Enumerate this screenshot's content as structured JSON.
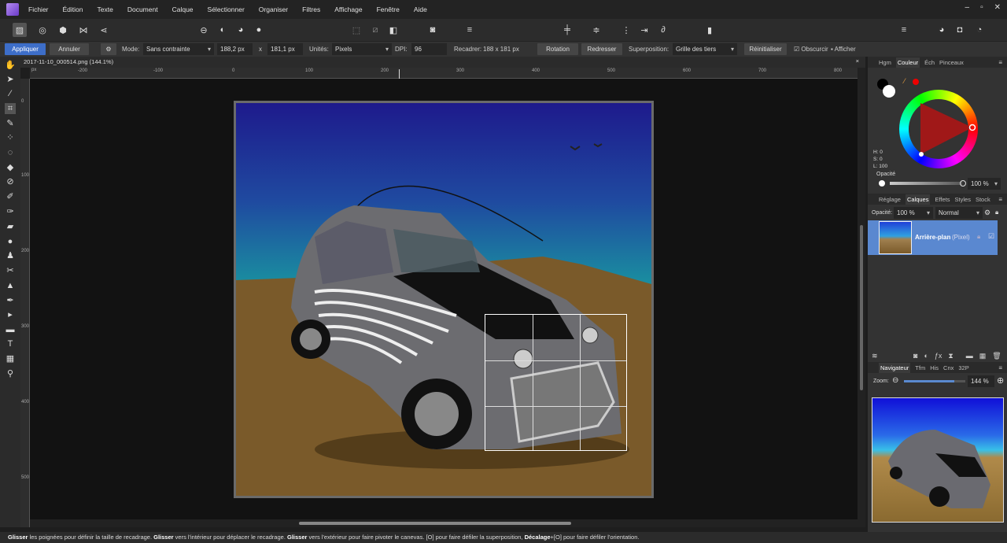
{
  "menu": [
    "Fichier",
    "Édition",
    "Texte",
    "Document",
    "Calque",
    "Sélectionner",
    "Organiser",
    "Filtres",
    "Affichage",
    "Fenêtre",
    "Aide"
  ],
  "window_controls": [
    "–",
    "▫",
    "✕"
  ],
  "context": {
    "apply": "Appliquer",
    "cancel": "Annuler",
    "mode_label": "Mode:",
    "mode_value": "Sans contrainte",
    "width": "188,2 px",
    "x_sep": "x",
    "height": "181,1 px",
    "units_label": "Unités:",
    "units_value": "Pixels",
    "dpi_label": "DPI:",
    "dpi_value": "96",
    "crop_label": "Recadrer:",
    "crop_value": "188 x 181 px",
    "rotation": "Rotation",
    "straighten": "Redresser",
    "overlay_label": "Superposition:",
    "overlay_value": "Grille des tiers",
    "reset": "Réinitialiser",
    "darken": "Obscurcir",
    "show": "Afficher"
  },
  "document": {
    "tab": "2017-11-10_000514.png (144.1%)",
    "close": "×"
  },
  "ruler": {
    "unit": "px",
    "h_ticks": [
      "-200",
      "-100",
      "0",
      "100",
      "200",
      "300",
      "400",
      "500",
      "600",
      "700",
      "800"
    ],
    "v_ticks": [
      "0",
      "100",
      "200",
      "300",
      "400",
      "500"
    ]
  },
  "color_panel": {
    "tabs": [
      "Hgm",
      "Couleur",
      "Éch",
      "Pinceaux"
    ],
    "active": "Couleur",
    "h": "H: 0",
    "s": "S: 0",
    "l": "L: 100",
    "opacity_label": "Opacité",
    "opacity_value": "100 %"
  },
  "layers_panel": {
    "tabs": [
      "Réglage",
      "Calques",
      "Effets",
      "Styles",
      "Stock"
    ],
    "active": "Calques",
    "opacity_label": "Opacité:",
    "opacity_value": "100 %",
    "blend": "Normal",
    "layer_name": "Arrière-plan",
    "layer_type": "(Pixel)"
  },
  "navigator": {
    "tabs": [
      "Navigateur",
      "Tfm",
      "His",
      "Cnx",
      "32P"
    ],
    "active": "Navigateur",
    "zoom_label": "Zoom:",
    "zoom_value": "144 %",
    "zoom_fraction": 0.82
  },
  "status": {
    "p1": "Glisser",
    "t1": " les poignées pour définir la taille de recadrage. ",
    "p2": "Glisser",
    "t2": " vers l'intérieur pour déplacer le recadrage. ",
    "p3": "Glisser",
    "t3": " vers l'extérieur pour faire pivoter le canevas. [O] pour faire défiler la superposition, ",
    "p4": "Décalage",
    "t4": "+[O] pour faire défiler l'orientation."
  },
  "colors": {
    "accent": "#3d6ec9",
    "layer_selected": "#5a88d0"
  }
}
